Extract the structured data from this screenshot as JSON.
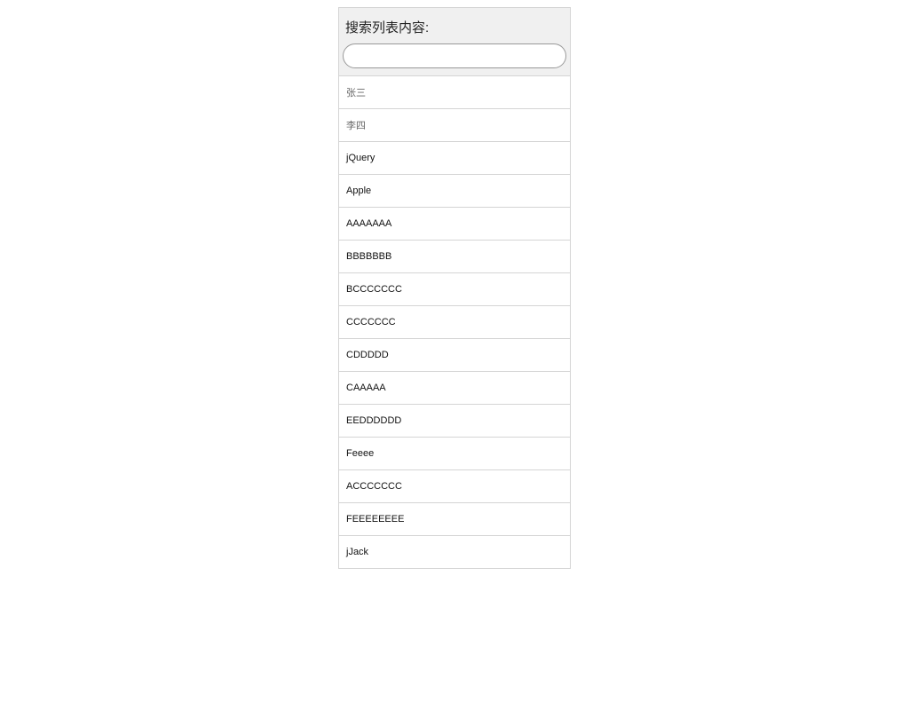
{
  "search": {
    "label": "搜索列表内容:",
    "value": "",
    "placeholder": ""
  },
  "list": {
    "items": [
      {
        "label": "张三",
        "cjk": true
      },
      {
        "label": "李四",
        "cjk": true
      },
      {
        "label": "jQuery"
      },
      {
        "label": "Apple"
      },
      {
        "label": "AAAAAAA"
      },
      {
        "label": "BBBBBBB"
      },
      {
        "label": "BCCCCCCC"
      },
      {
        "label": "CCCCCCC"
      },
      {
        "label": "CDDDDD"
      },
      {
        "label": "CAAAAA"
      },
      {
        "label": "EEDDDDDD"
      },
      {
        "label": "Feeee"
      },
      {
        "label": "ACCCCCCC"
      },
      {
        "label": "FEEEEEEEE"
      },
      {
        "label": "jJack"
      }
    ]
  },
  "colors": {
    "header_bg": "#f0f0f0",
    "border": "#d4d4d4"
  }
}
